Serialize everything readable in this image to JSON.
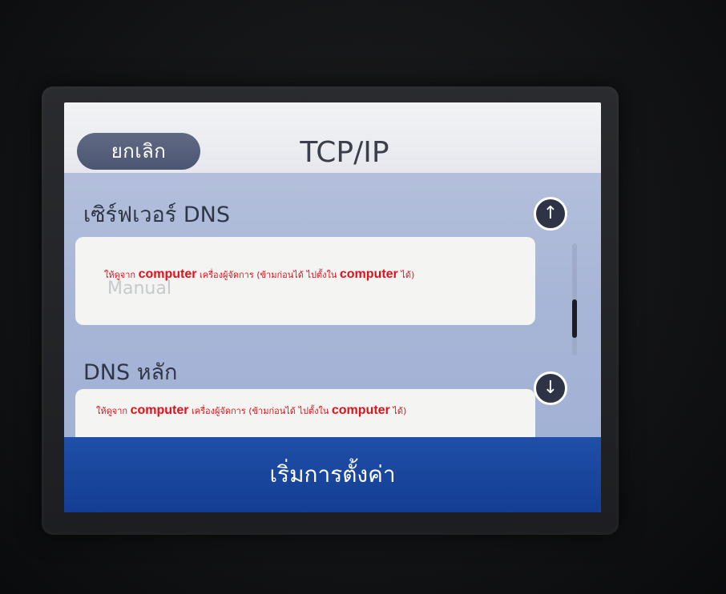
{
  "header": {
    "cancel_label": "ยกเลิก",
    "title": "TCP/IP"
  },
  "dns_server": {
    "label": "เซิร์ฟเวอร์ DNS",
    "value": "Manual",
    "annotation_prefix": "ให้ดูจาก",
    "annotation_bold_1": "computer",
    "annotation_middle": "เครื่องผู้จัดการ   (ข้ามก่อนได้ ไปตั้งใน",
    "annotation_bold_2": "computer",
    "annotation_suffix": "ได้)"
  },
  "primary_dns": {
    "label": "DNS หลัก",
    "annotation_prefix": "ให้ดูจาก",
    "annotation_bold_1": "computer",
    "annotation_middle": "เครื่องผู้จัดการ   (ข้ามก่อนได้ ไปตั้งใน",
    "annotation_bold_2": "computer",
    "annotation_suffix": "ได้)"
  },
  "scroll": {
    "up_icon": "arrow-up-icon",
    "down_icon": "arrow-down-icon",
    "position": 0.5
  },
  "footer": {
    "start_label": "เริ่มการตั้งค่า"
  },
  "colors": {
    "annotation": "#e3101a",
    "footer": "#1f4fa8",
    "cancel": "#565f7b"
  }
}
